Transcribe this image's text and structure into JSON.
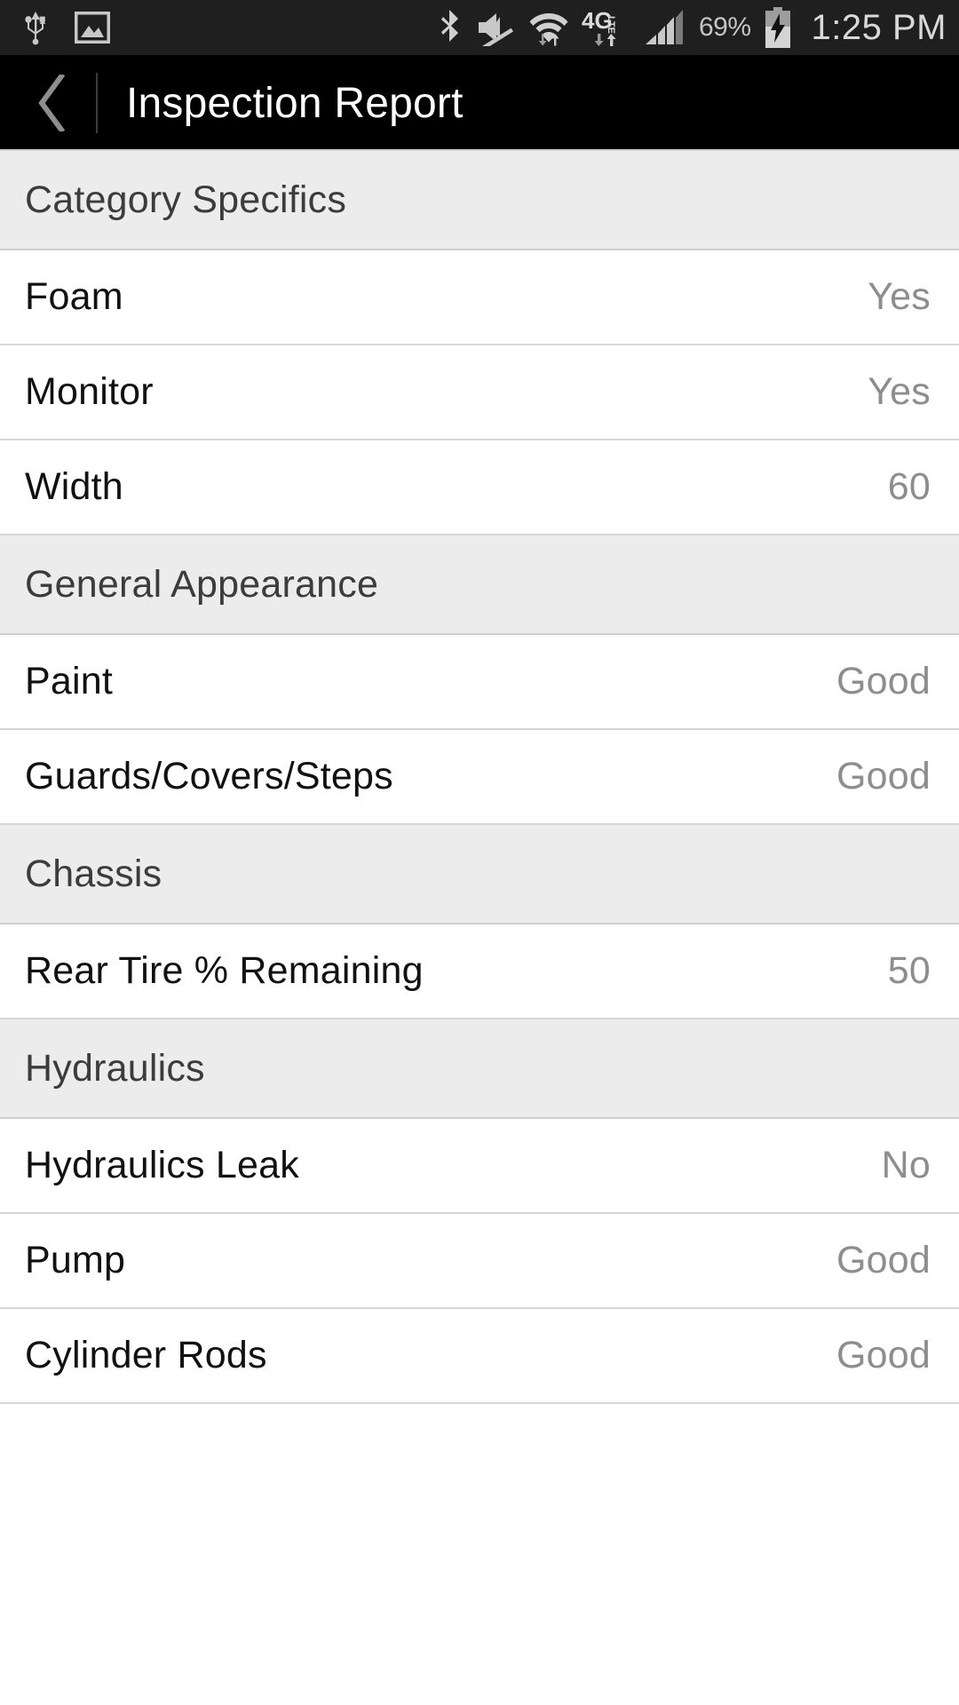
{
  "statusbar": {
    "left_icons": [
      "usb-icon",
      "screenshot-image-icon"
    ],
    "right_icons": [
      "bluetooth-icon",
      "volume-muted-icon",
      "wifi-icon",
      "network-4g-lte-icon",
      "cellular-signal-icon",
      "battery-charging-icon"
    ],
    "battery_percent": "69%",
    "network_label": "4G",
    "network_sub_label": "LTE",
    "time": "1:25 PM"
  },
  "actionbar": {
    "back_icon": "back-chevron-icon",
    "title": "Inspection Report"
  },
  "colors": {
    "statusbar_bg": "#1f1f1f",
    "actionbar_bg": "#000000",
    "section_bg": "#ececec",
    "row_bg": "#ffffff",
    "divider": "#d6d6d6",
    "label_text": "#111111",
    "value_text": "#8d8d8d",
    "section_text": "#3c3c3c"
  },
  "list": [
    {
      "type": "section",
      "label": "Category Specifics"
    },
    {
      "type": "row",
      "label": "Foam",
      "value": "Yes"
    },
    {
      "type": "row",
      "label": "Monitor",
      "value": "Yes"
    },
    {
      "type": "row",
      "label": "Width",
      "value": "60"
    },
    {
      "type": "section",
      "label": "General Appearance"
    },
    {
      "type": "row",
      "label": "Paint",
      "value": "Good"
    },
    {
      "type": "row",
      "label": "Guards/Covers/Steps",
      "value": "Good"
    },
    {
      "type": "section",
      "label": "Chassis"
    },
    {
      "type": "row",
      "label": "Rear Tire % Remaining",
      "value": "50"
    },
    {
      "type": "section",
      "label": "Hydraulics"
    },
    {
      "type": "row",
      "label": "Hydraulics Leak",
      "value": "No"
    },
    {
      "type": "row",
      "label": "Pump",
      "value": "Good"
    },
    {
      "type": "row",
      "label": "Cylinder Rods",
      "value": "Good"
    }
  ]
}
